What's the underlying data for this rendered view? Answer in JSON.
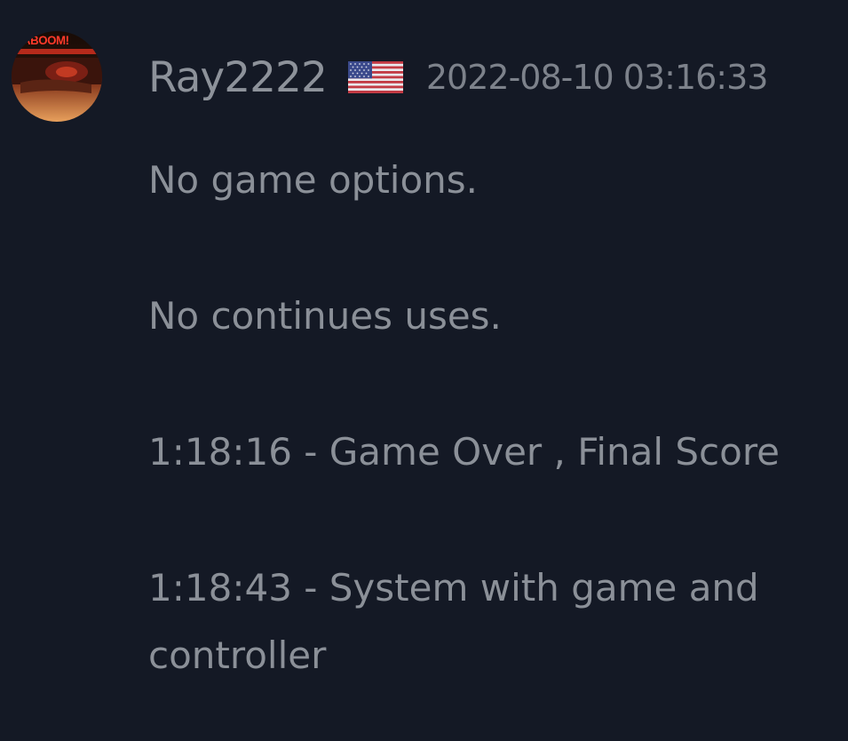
{
  "comment": {
    "avatar": {
      "logo_text": "ABOOM!",
      "colors": {
        "top": "#1a0d08",
        "band": "#c0271c",
        "bottom": "#e89a52"
      }
    },
    "username": "Ray2222",
    "country_flag": "us-flag-icon",
    "timestamp": "2022-08-10 03:16:33",
    "lines": [
      "No game options.",
      "No continues uses.",
      "1:18:16 - Game Over , Final Score",
      "1:18:43 - System with game and",
      "controller"
    ]
  },
  "colors": {
    "background": "#141925",
    "text": "#8b9098"
  }
}
